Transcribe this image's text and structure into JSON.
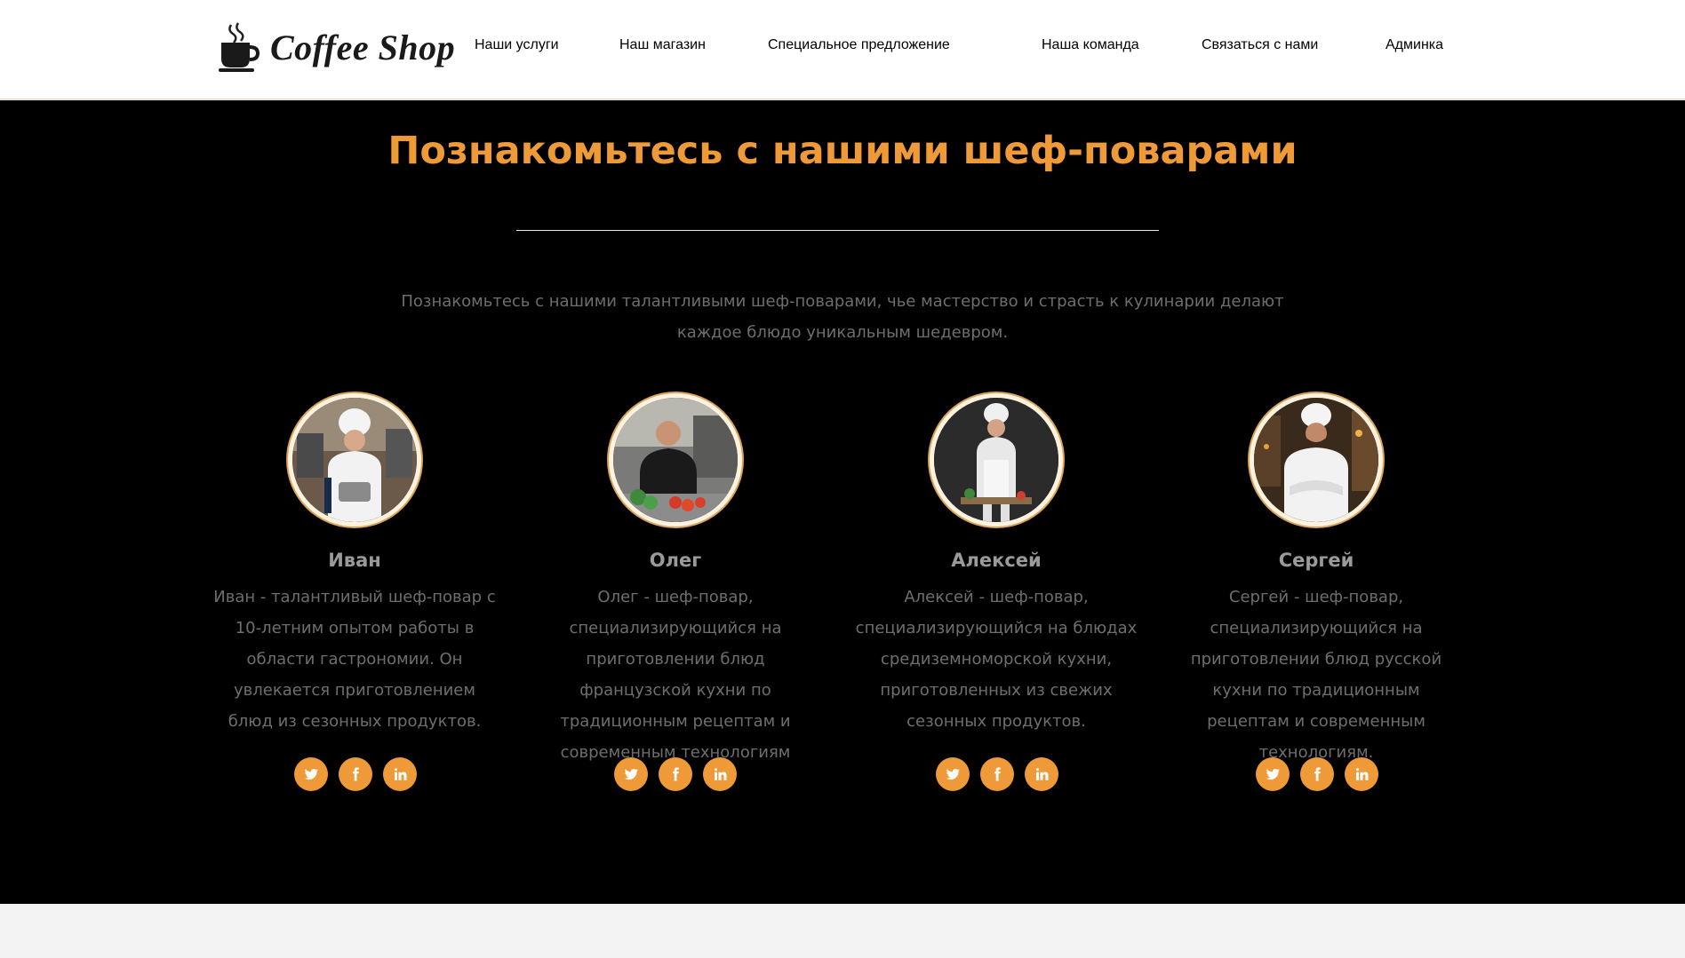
{
  "brand": {
    "name": "Coffee Shop",
    "accent": "#ef9a38"
  },
  "nav": [
    "Наши услуги",
    "Наш магазин",
    "Специальное предложение",
    "Наша команда",
    "Связаться с нами",
    "Админка"
  ],
  "team": {
    "title": "Познакомьтесь с нашими шеф-поварами",
    "description": "Познакомьтесь с нашими талантливыми шеф-поварами, чье мастерство и страсть к кулинарии делают каждое блюдо уникальным шедевром.",
    "members": [
      {
        "name": "Иван",
        "bio": "Иван - талантливый шеф-повар с 10-летним опытом работы в области гастрономии. Он увлекается приготовлением блюд из сезонных продуктов."
      },
      {
        "name": "Олег",
        "bio": "Олег - шеф-повар, специализирующийся на приготовлении блюд французской кухни по традиционным рецептам и современным технологиям"
      },
      {
        "name": "Алексей",
        "bio": "Алексей - шеф-повар, специализирующийся на блюдах средиземноморской кухни, приготовленных из свежих сезонных продуктов."
      },
      {
        "name": "Сергей",
        "bio": "Сергей - шеф-повар, специализирующийся на приготовлении блюд русской кухни по традиционным рецептам и современным технологиям."
      }
    ],
    "social_icons": [
      "twitter-icon",
      "facebook-icon",
      "linkedin-icon"
    ]
  }
}
